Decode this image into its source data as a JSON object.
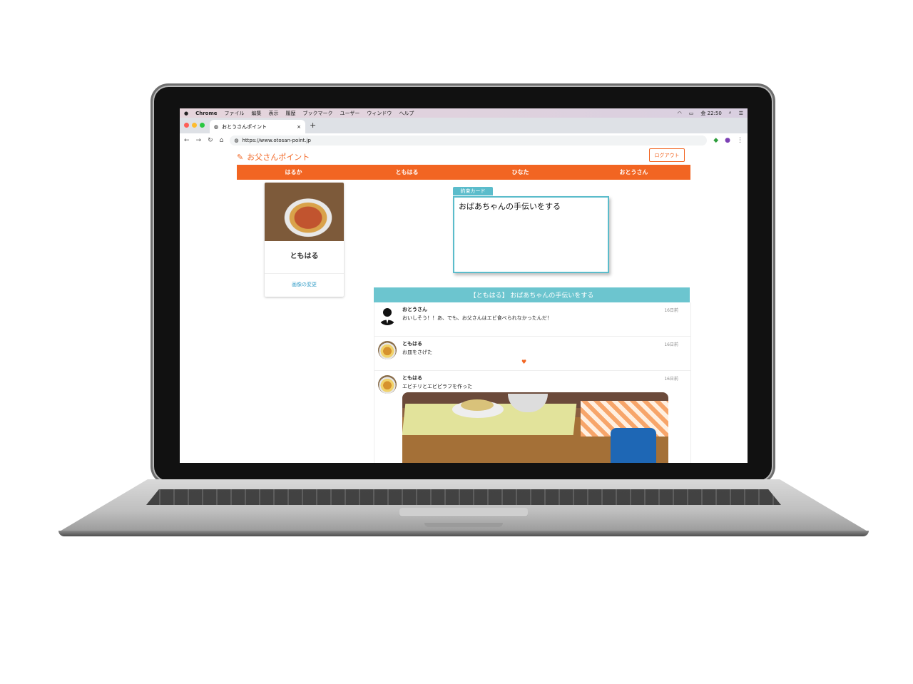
{
  "menubar": {
    "app": "Chrome",
    "items": [
      "ファイル",
      "編集",
      "表示",
      "履歴",
      "ブックマーク",
      "ユーザー",
      "ウィンドウ",
      "ヘルプ"
    ],
    "clock": "金 22:50"
  },
  "browser": {
    "tab_title": "おとうさんポイント",
    "new_tab": "+",
    "close": "×",
    "url": "https://www.otosan-point.jp"
  },
  "site": {
    "brand": "お父さんポイント",
    "logout": "ログアウト",
    "nav": [
      "はるか",
      "ともはる",
      "ひなた",
      "おとうさん"
    ]
  },
  "profile": {
    "name": "ともはる",
    "change_image": "画像の変更"
  },
  "promise_card": {
    "tag": "約束カード",
    "text": "おばあちゃんの手伝いをする"
  },
  "thread": {
    "title": "【ともはる】 おばあちゃんの手伝いをする",
    "posts": [
      {
        "author": "おとうさん",
        "message": "おいしそう！！あ、でも、お父さんはエビ食べられなかったんだ！",
        "time": "16日前"
      },
      {
        "author": "ともはる",
        "message": "お皿をさげた",
        "time": "16日前",
        "heart": "♥"
      },
      {
        "author": "ともはる",
        "message": "エビチリとエビピラフを作った",
        "time": "16日前"
      }
    ]
  },
  "colors": {
    "accent": "#f26522",
    "teal": "#6cc5cf"
  }
}
